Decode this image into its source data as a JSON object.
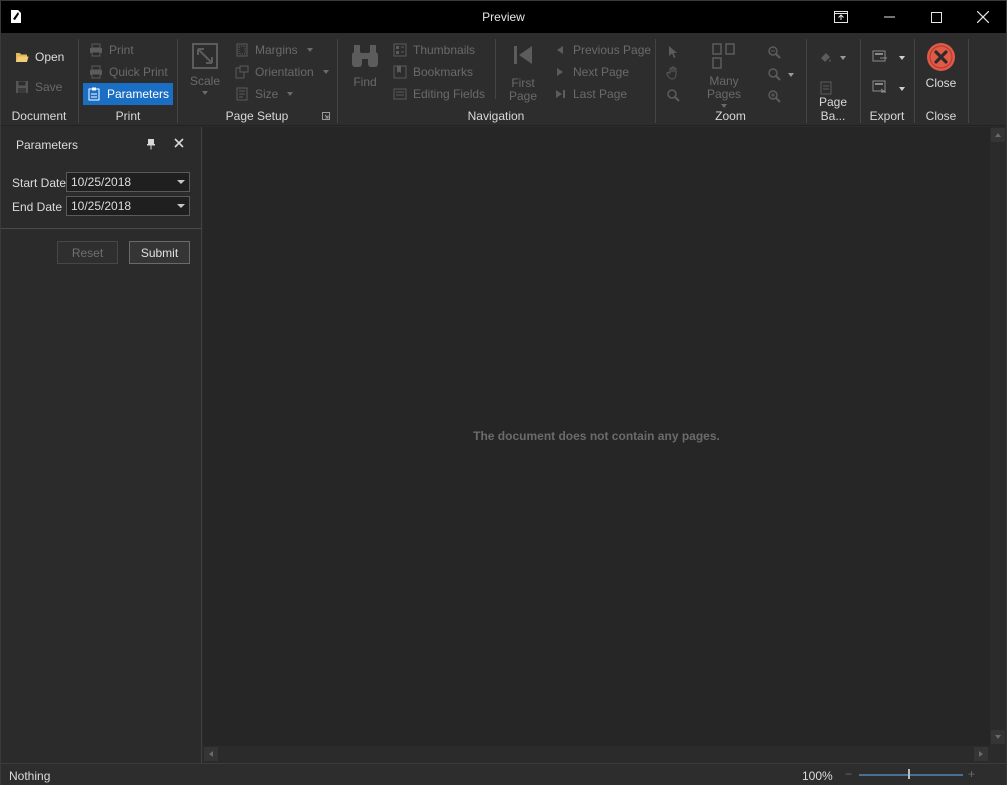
{
  "window": {
    "title": "Preview"
  },
  "ribbon": {
    "document": {
      "label": "Document",
      "open": "Open",
      "save": "Save"
    },
    "print": {
      "label": "Print",
      "print": "Print",
      "quick_print": "Quick Print",
      "parameters": "Parameters"
    },
    "page_setup": {
      "label": "Page Setup",
      "scale": "Scale",
      "margins": "Margins",
      "orientation": "Orientation",
      "size": "Size"
    },
    "navigation": {
      "label": "Navigation",
      "find": "Find",
      "thumbnails": "Thumbnails",
      "bookmarks": "Bookmarks",
      "editing_fields": "Editing Fields",
      "first_page_1": "First",
      "first_page_2": "Page",
      "previous_page": "Previous Page",
      "next_page": "Next  Page",
      "last_page": "Last  Page"
    },
    "zoom": {
      "label": "Zoom",
      "many_pages": "Many Pages"
    },
    "page_background": {
      "label": "Page Ba..."
    },
    "export": {
      "label": "Export"
    },
    "close": {
      "label": "Close",
      "close": "Close"
    }
  },
  "parameters_panel": {
    "title": "Parameters",
    "start_date_label": "Start Date",
    "start_date_value": "10/25/2018",
    "end_date_label": "End Date",
    "end_date_value": "10/25/2018",
    "reset": "Reset",
    "submit": "Submit"
  },
  "document": {
    "empty_message": "The document does not contain any pages."
  },
  "status_bar": {
    "status": "Nothing",
    "zoom": "100%",
    "zoom_minus": "−",
    "zoom_plus": "+"
  },
  "colors": {
    "accent": "#1a6fc4",
    "close_red": "#e05a47",
    "background": "#2b2b2b",
    "titlebar": "#000000"
  }
}
